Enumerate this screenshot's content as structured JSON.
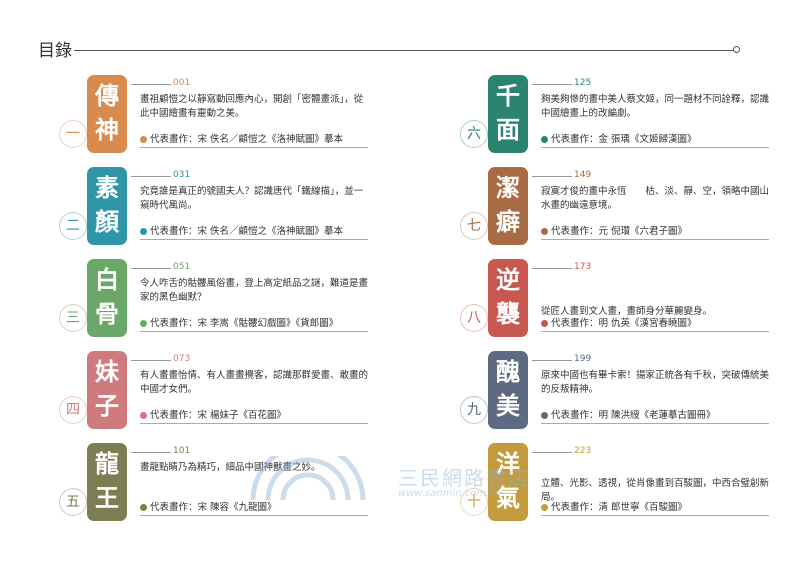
{
  "header": {
    "title": "目錄"
  },
  "watermark": {
    "text": "三民網路書店",
    "url": "www.sanmin.com.tw"
  },
  "entries": [
    {
      "num": "一",
      "tile": [
        "傳",
        "神"
      ],
      "page": "001",
      "color": "#d98a4d",
      "desc": "畫祖顧愷之以靜寫動回應內心，開創「密體畫派」，從此中國繪畫有靈動之美。",
      "rep": "代表畫作：宋 佚名／顧愷之《洛神賦圖》摹本"
    },
    {
      "num": "二",
      "tile": [
        "素",
        "顏"
      ],
      "page": "031",
      "color": "#2e94a8",
      "desc": "究竟誰是真正的號國夫人？認識唐代「鐵線描」，並一窺時代風尚。",
      "rep": "代表畫作：宋 佚名／顧愷之《洛神賦圖》摹本"
    },
    {
      "num": "三",
      "tile": [
        "白",
        "骨"
      ],
      "page": "051",
      "color": "#6aa86a",
      "desc": "令人咋舌的骷髏風俗畫，登上高定紙品之謎，難道是畫家的黑色幽默？",
      "rep": "代表畫作：宋 李嵩《骷髏幻戲圖》《貨郎圖》"
    },
    {
      "num": "四",
      "tile": [
        "妹",
        "子"
      ],
      "page": "073",
      "color": "#cf7b7d",
      "desc": "有人畫畫怡情、有人畫畫攪客，認識那群愛畫、敢畫的中國才女們。",
      "rep": "代表畫作：宋 楊妹子《百花圖》"
    },
    {
      "num": "五",
      "tile": [
        "龍",
        "王"
      ],
      "page": "101",
      "color": "#7c7d52",
      "desc": "畫龍點睛乃為精巧，細品中國神獸畫之妙。",
      "rep": "代表畫作：宋 陳容《九龍圖》"
    },
    {
      "num": "六",
      "tile": [
        "千",
        "面"
      ],
      "page": "125",
      "color": "#2b8470",
      "desc": "夠美夠慘的畫中美人蔡文姬，同一題材不同詮釋，認識中國繪畫上的改編劇。",
      "rep": "代表畫作：金 張瑀《文姬歸漢圖》"
    },
    {
      "num": "七",
      "tile": [
        "潔",
        "癖"
      ],
      "page": "149",
      "color": "#a86b43",
      "desc": "寂寞才俊的畫中永恆　　枯、淡、靜、空，領略中國山水畫的幽遠意境。",
      "rep": "代表畫作：元 倪瓚《六君子圖》"
    },
    {
      "num": "八",
      "tile": [
        "逆",
        "襲"
      ],
      "page": "173",
      "color": "#c8574f",
      "desc": "從匠人畫到文人畫，畫師身分華麗變身。",
      "rep": "代表畫作：明 仇英《漢宮春曉圖》"
    },
    {
      "num": "九",
      "tile": [
        "醜",
        "美"
      ],
      "page": "199",
      "color": "#5e6a82",
      "desc": "原來中國也有畢卡索！揚家正統各有千秋，突破傳統美的反叛精神。",
      "rep": "代表畫作：明 陳洪綬《老蓮摹古圖冊》"
    },
    {
      "num": "十",
      "tile": [
        "洋",
        "氣"
      ],
      "page": "223",
      "color": "#c39b3d",
      "desc": "立體、光影、透視，從肖像畫到百駿圖，中西合璧創新局。",
      "rep": "代表畫作：清 郎世寧《百駿圖》"
    }
  ]
}
